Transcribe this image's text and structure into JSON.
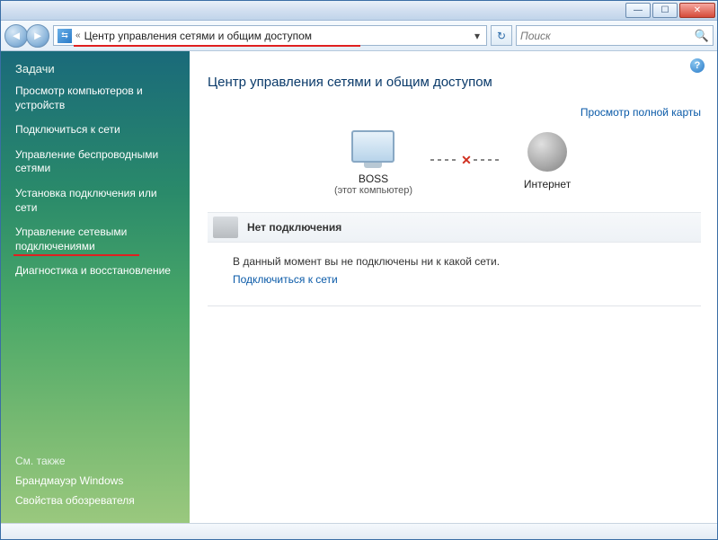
{
  "titlebar": {
    "minimize_glyph": "—",
    "maximize_glyph": "☐",
    "close_glyph": "✕"
  },
  "nav": {
    "back_glyph": "◄",
    "forward_glyph": "►",
    "addr_chevron": "«",
    "address": "Центр управления сетями и общим доступом",
    "dropdown_glyph": "▾",
    "refresh_glyph": "↻",
    "search_placeholder": "Поиск",
    "search_icon": "🔍"
  },
  "sidebar": {
    "header": "Задачи",
    "tasks": [
      "Просмотр компьютеров и устройств",
      "Подключиться к сети",
      "Управление беспроводными сетями",
      "Установка подключения или сети",
      "Управление сетевыми подключениями",
      "Диагностика и восстановление"
    ],
    "see_also": "См. также",
    "bottom": [
      "Брандмауэр Windows",
      "Свойства обозревателя"
    ]
  },
  "main": {
    "help_glyph": "?",
    "title": "Центр управления сетями и общим доступом",
    "map_link": "Просмотр полной карты",
    "node_pc": "BOSS",
    "node_pc_sub": "(этот компьютер)",
    "node_internet": "Интернет",
    "conn_x": "✕",
    "section_title": "Нет подключения",
    "message": "В данный момент вы не подключены ни к какой сети.",
    "connect_link": "Подключиться к сети"
  }
}
